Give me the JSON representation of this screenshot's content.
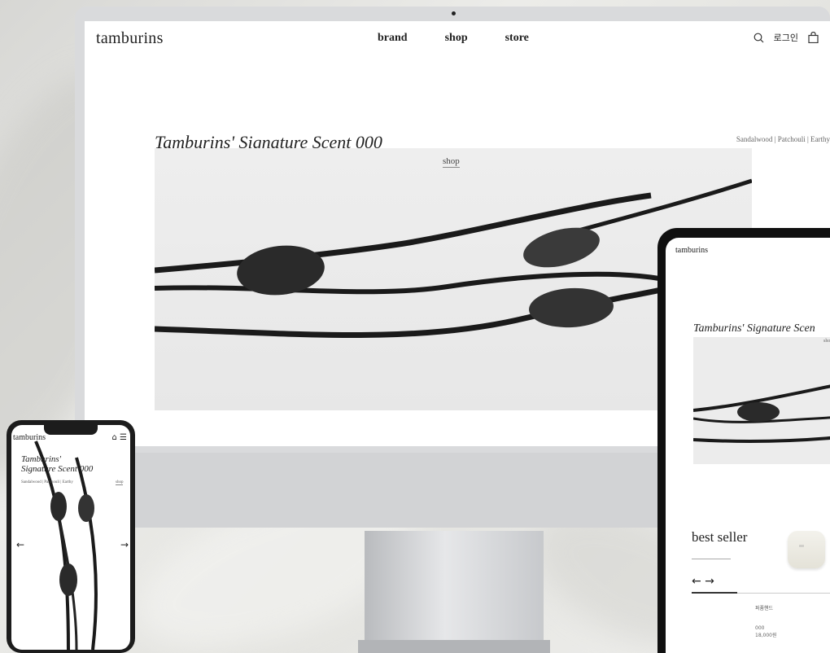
{
  "desktop": {
    "logo": "tamburins",
    "nav": [
      "brand",
      "shop",
      "store"
    ],
    "login": "로그인",
    "hero": {
      "title": "Tamburins' Signature Scent 000",
      "notes": "Sandalwood | Patchouli | Earthy",
      "shop": "shop"
    }
  },
  "tablet": {
    "logo": "tamburins",
    "title": "Tamburins' Signature Scen",
    "shop": "sho",
    "best_seller": "best seller",
    "arrows": "←  →",
    "product_brand": "퍼퓸핸드",
    "product_name": "000",
    "product_price": "18,000원"
  },
  "phone": {
    "logo": "tamburins",
    "title": "Tamburins' Signature Scent 000",
    "notes": "Sandalwood | Patchouli | Earthy",
    "shop": "shop",
    "arrow_left": "←",
    "arrow_right": "→"
  }
}
